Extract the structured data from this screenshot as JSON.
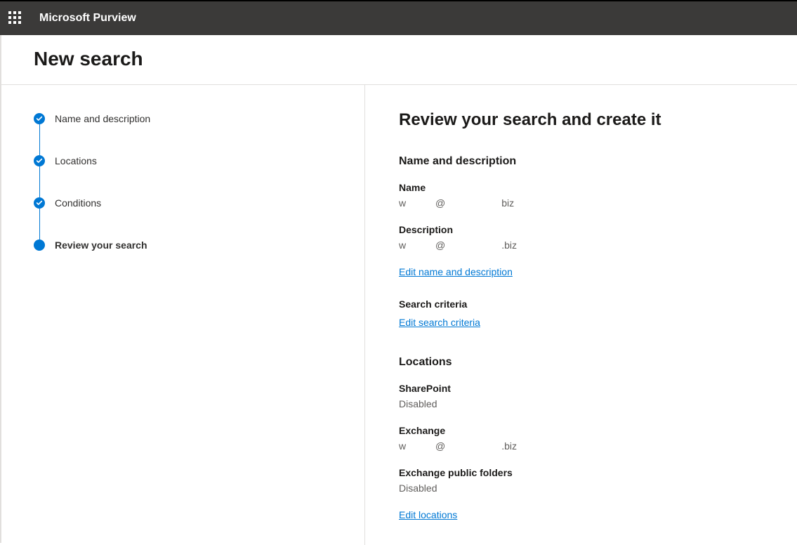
{
  "header": {
    "app_title": "Microsoft Purview",
    "page_title": "New search"
  },
  "wizard": {
    "steps": [
      {
        "label": "Name and description",
        "state": "completed"
      },
      {
        "label": "Locations",
        "state": "completed"
      },
      {
        "label": "Conditions",
        "state": "completed"
      },
      {
        "label": "Review your search",
        "state": "current"
      }
    ]
  },
  "review": {
    "title": "Review your search and create it",
    "sections": {
      "name_desc": {
        "heading": "Name and description",
        "name_label": "Name",
        "name_value_parts": [
          "w",
          "@",
          "biz"
        ],
        "desc_label": "Description",
        "desc_value_parts": [
          "w",
          "@",
          ".biz"
        ],
        "edit_link": "Edit name and description"
      },
      "criteria": {
        "heading": "Search criteria",
        "edit_link": "Edit search criteria"
      },
      "locations": {
        "heading": "Locations",
        "sharepoint_label": "SharePoint",
        "sharepoint_value": "Disabled",
        "exchange_label": "Exchange",
        "exchange_value_parts": [
          "w",
          "@",
          ".biz"
        ],
        "public_folders_label": "Exchange public folders",
        "public_folders_value": "Disabled",
        "edit_link": "Edit locations"
      }
    }
  }
}
